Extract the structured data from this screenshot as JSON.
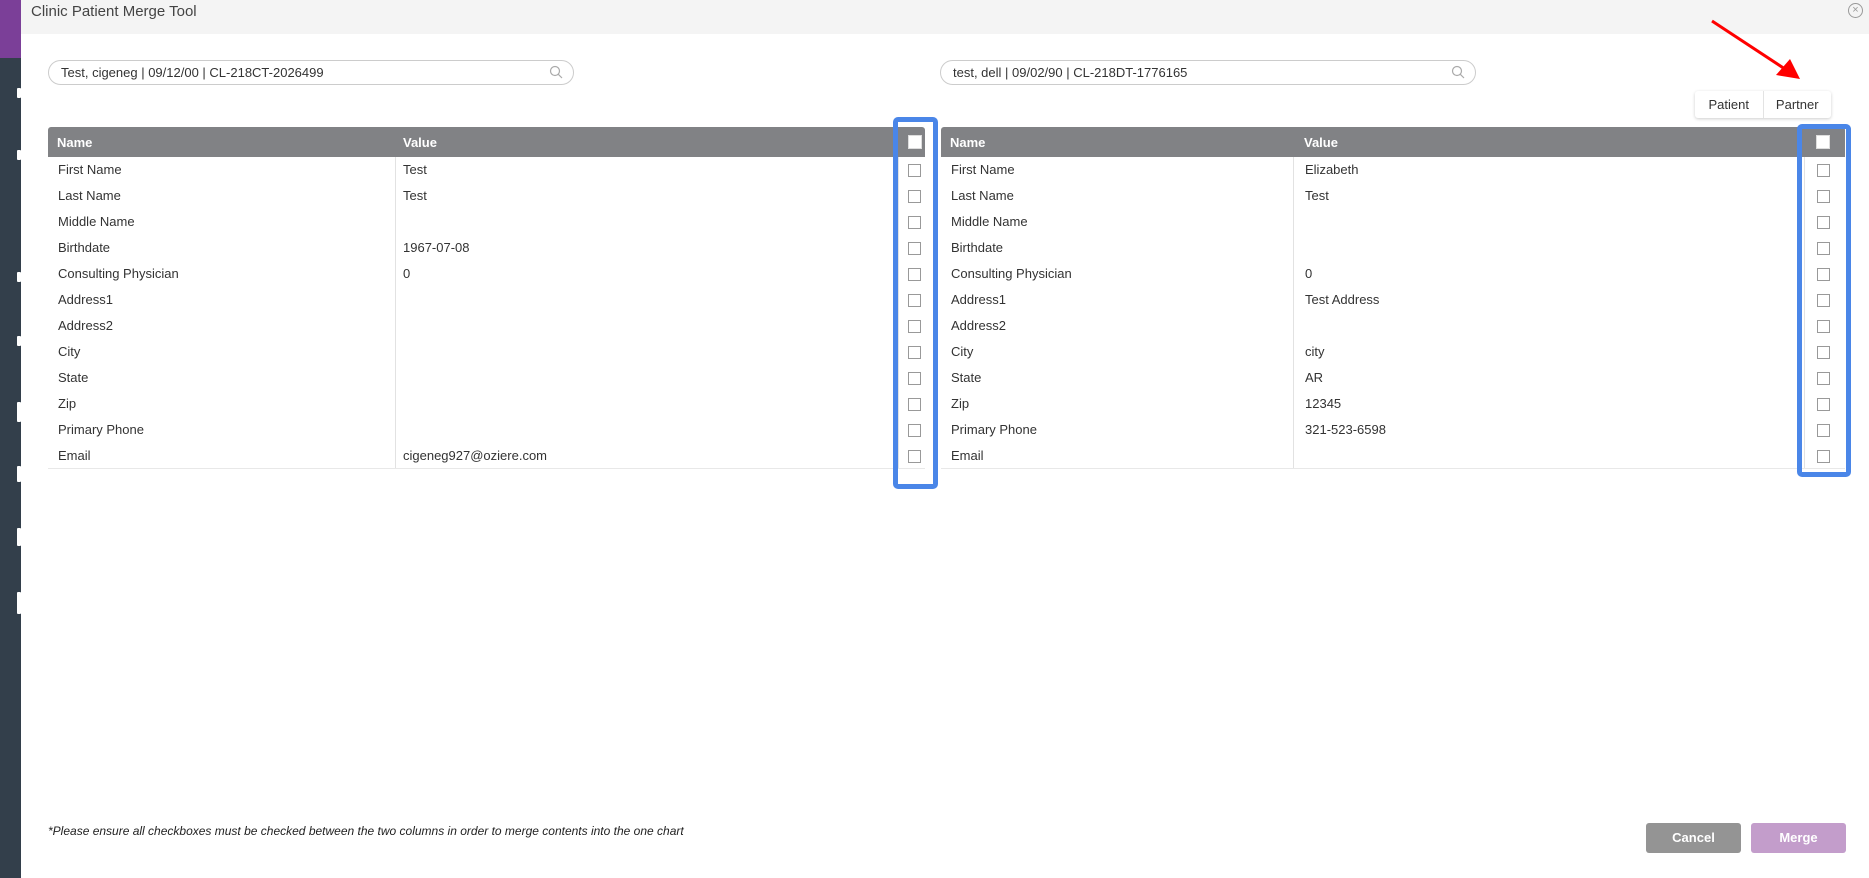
{
  "window": {
    "title": "Clinic Patient Merge Tool"
  },
  "left": {
    "search_value": "Test, cigeneg | 09/12/00 | CL-218CT-2026499"
  },
  "right": {
    "search_value": "test, dell | 09/02/90 | CL-218DT-1776165"
  },
  "toggle": {
    "patient": "Patient",
    "partner": "Partner"
  },
  "table_headers": {
    "name": "Name",
    "value": "Value"
  },
  "fields": [
    "First Name",
    "Last Name",
    "Middle Name",
    "Birthdate",
    "Consulting Physician",
    "Address1",
    "Address2",
    "City",
    "State",
    "Zip",
    "Primary Phone",
    "Email"
  ],
  "left_values": [
    "Test",
    "Test",
    "",
    "1967-07-08",
    "0",
    "",
    "",
    "",
    "",
    "",
    "",
    "cigeneg927@oziere.com"
  ],
  "right_values": [
    "Elizabeth",
    "Test",
    "",
    "",
    "0",
    "Test Address",
    "",
    "city",
    "AR",
    "12345",
    "321-523-6598",
    ""
  ],
  "footer": {
    "note": "*Please ensure all checkboxes must be checked between the two columns in order to merge contents into the one chart",
    "cancel": "Cancel",
    "merge": "Merge"
  },
  "colors": {
    "sidebar": "#333f4b",
    "accent": "#7b3f98",
    "header": "#818285",
    "highlight": "#4a86e8",
    "cancel": "#949494",
    "merge": "#c39dcb",
    "annotation_arrow": "#ff0000"
  }
}
